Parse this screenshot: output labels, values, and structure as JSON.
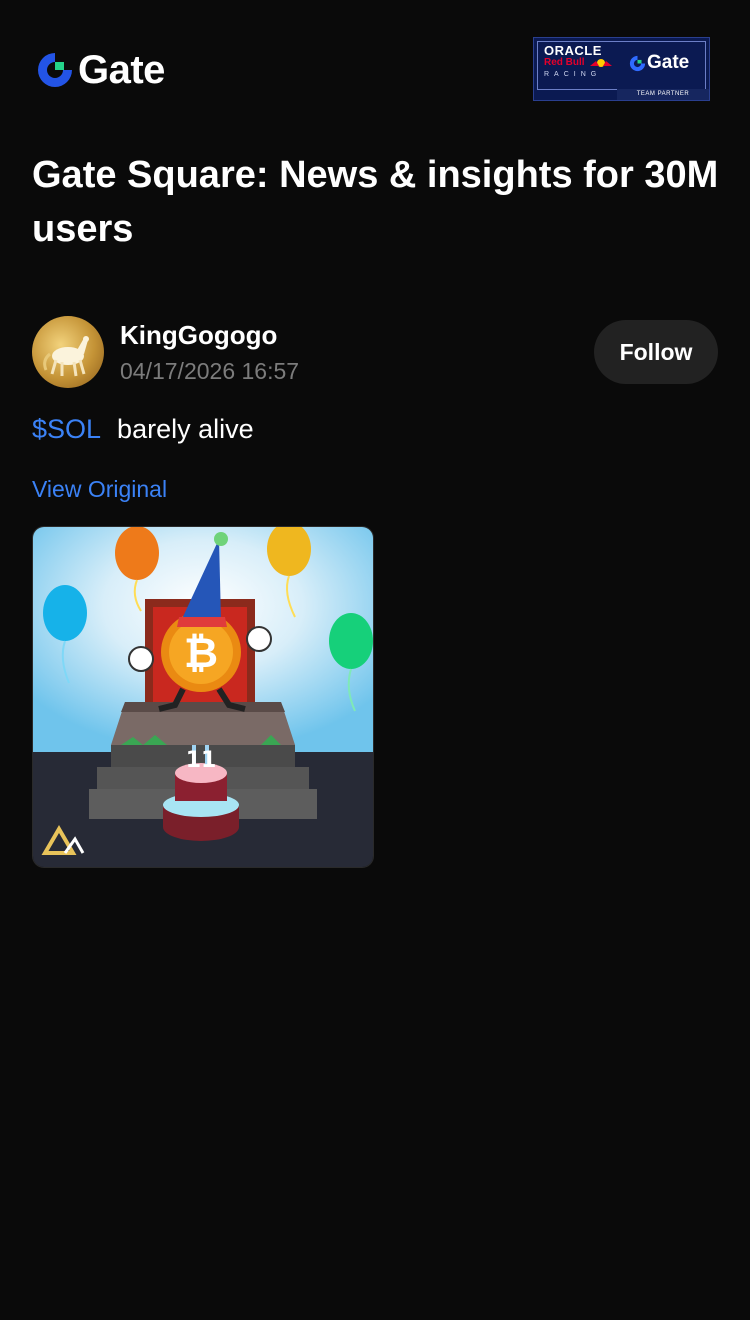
{
  "header": {
    "brand_name": "Gate",
    "partner": {
      "oracle": "ORACLE",
      "redbull": "Red Bull",
      "racing": "RACING",
      "brand_name": "Gate",
      "team_partner": "TEAM PARTNER"
    }
  },
  "page": {
    "title": "Gate Square: News & insights for 30M users"
  },
  "post": {
    "author": "KingGogogo",
    "timestamp": "04/17/2026 16:57",
    "follow_label": "Follow",
    "ticker": "$SOL",
    "text": "barely alive",
    "view_original_label": "View Original",
    "image_icon": "bitcoin-birthday-illustration",
    "cake_number": "11"
  },
  "colors": {
    "background": "#0a0a0a",
    "accent_blue": "#3b82f6",
    "muted_text": "#7c7c7c",
    "button_bg": "#222222"
  }
}
